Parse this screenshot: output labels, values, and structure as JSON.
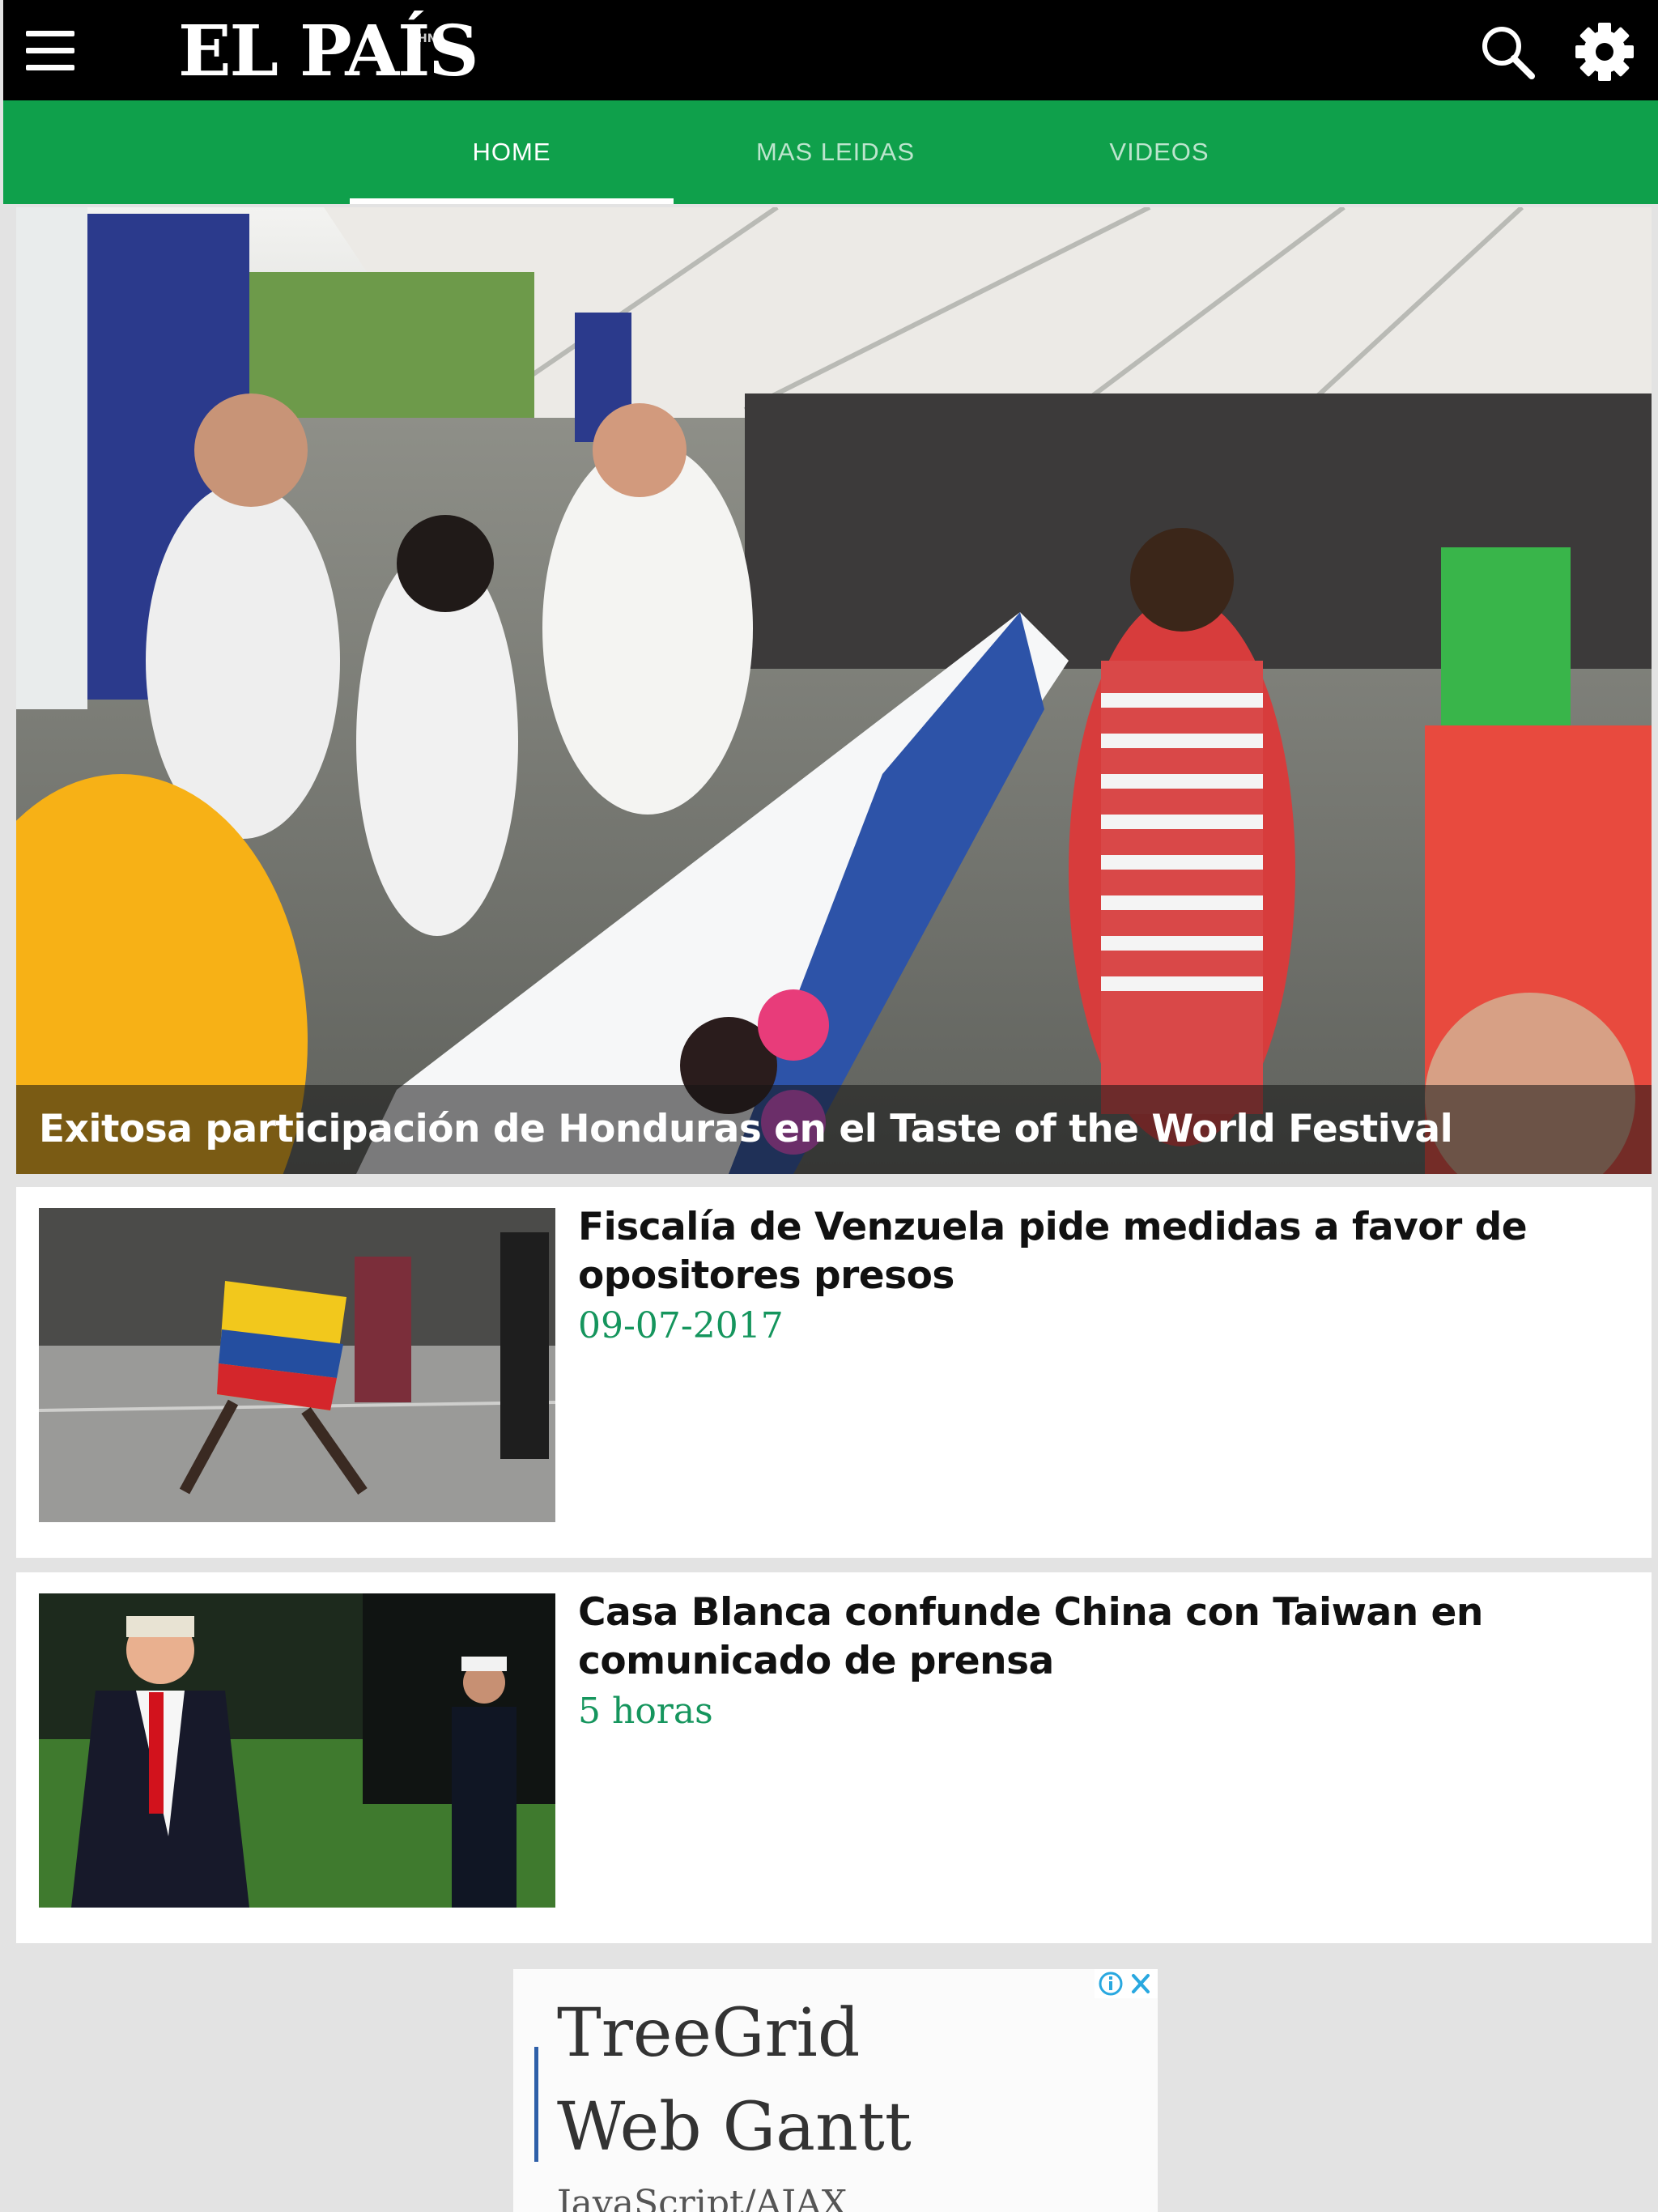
{
  "header": {
    "logo_text": "EL PAÍS",
    "logo_superscript": "HN",
    "menu_icon": "hamburger-menu-icon",
    "search_icon": "search-icon",
    "settings_icon": "gear-icon"
  },
  "tabs": [
    {
      "label": "HOME",
      "active": true
    },
    {
      "label": "MAS LEIDAS",
      "active": false
    },
    {
      "label": "VIDEOS",
      "active": false
    }
  ],
  "hero": {
    "title": "Exitosa participación de Honduras en el Taste of the World Festival"
  },
  "articles": [
    {
      "title": "Fiscalía de Venzuela pide medidas a favor de opositores presos",
      "date": "09-07-2017"
    },
    {
      "title": "Casa Blanca confunde China con Taiwan en comunicado de prensa",
      "date": "5 horas"
    }
  ],
  "ad": {
    "line1": "TreeGrid",
    "line2": "Web Gantt",
    "line3": "JavaScript/AJAX"
  },
  "colors": {
    "header_bg": "#000000",
    "tab_bar": "#0fa04b",
    "date_text": "#15955d",
    "page_bg": "#e3e3e3"
  }
}
